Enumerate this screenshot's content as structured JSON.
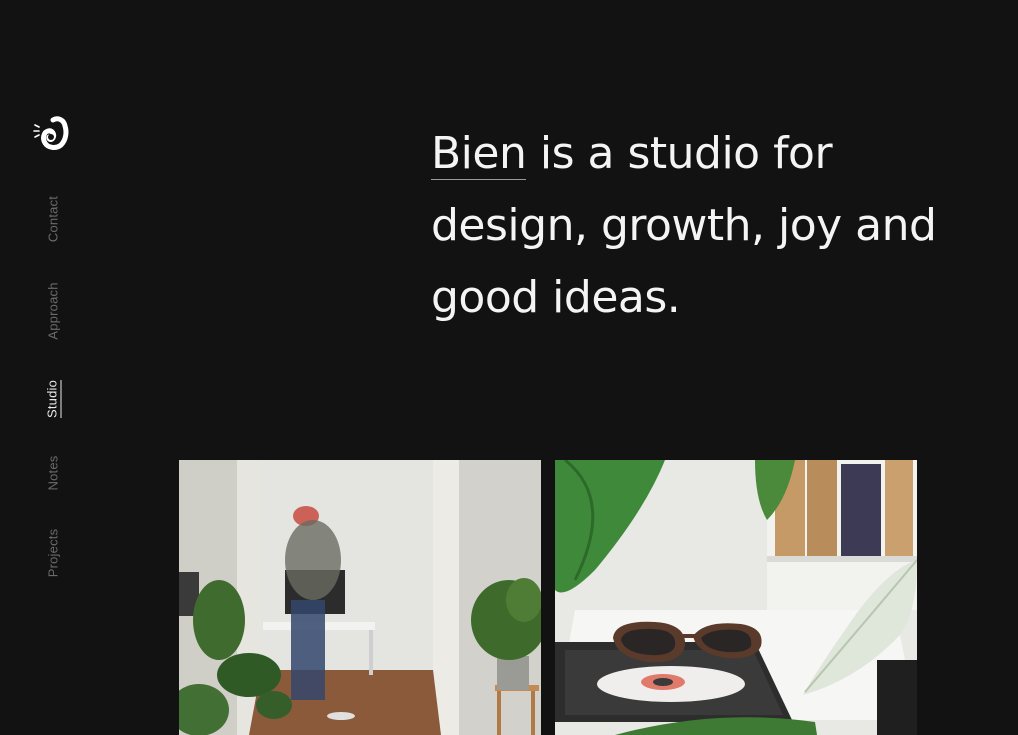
{
  "brand": {
    "logo_icon": "ok-hand-icon"
  },
  "sidebar": {
    "items": [
      {
        "label": "Contact",
        "active": false
      },
      {
        "label": "Approach",
        "active": false
      },
      {
        "label": "Studio",
        "active": true
      },
      {
        "label": "Notes",
        "active": false
      },
      {
        "label": "Projects",
        "active": false
      }
    ]
  },
  "hero": {
    "brand_word": "Bien",
    "rest": " is a studio for design, growth, joy and good ideas."
  },
  "photos": [
    {
      "name": "office-photo"
    },
    {
      "name": "sunglasses-photo"
    }
  ],
  "colors": {
    "background": "#121212",
    "text": "#f4f4f4",
    "nav_inactive": "#6b6b6b"
  }
}
